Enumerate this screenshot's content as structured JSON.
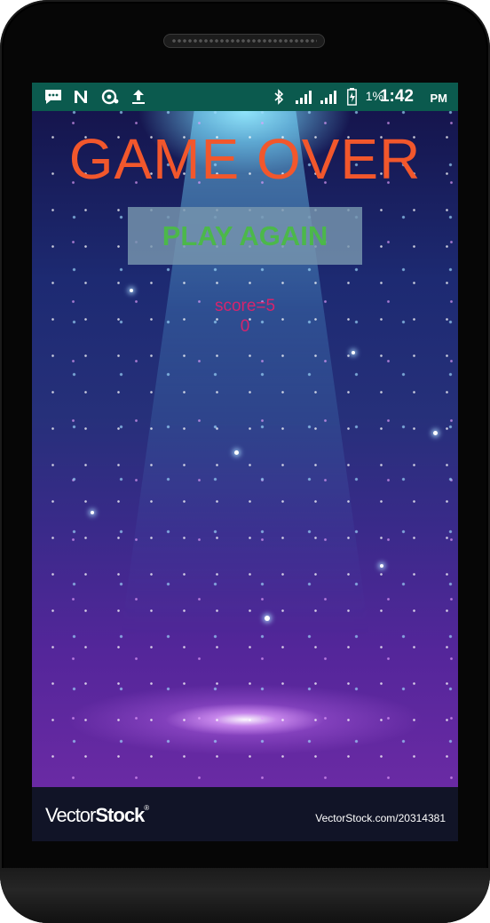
{
  "status_bar": {
    "notification_icons": [
      "message-icon",
      "n-icon",
      "camera-icon",
      "upload-icon"
    ],
    "right_icons": [
      "bluetooth-icon",
      "signal-icon",
      "signal-icon",
      "battery-charging-icon"
    ],
    "battery_percent": "1%",
    "time": "1:42",
    "ampm": "PM",
    "background_color": "#0b5a4e"
  },
  "game": {
    "title": "GAME OVER",
    "play_again_label": "PLAY AGAIN",
    "score_text": "score=5\n0",
    "title_color": "#f2572c",
    "button_text_color": "#4cb84a",
    "score_color": "#d6246d"
  },
  "watermark": {
    "logo_thin": "Vector",
    "logo_bold": "Stock",
    "logo_mark": "®",
    "url": "VectorStock.com/20314381"
  }
}
